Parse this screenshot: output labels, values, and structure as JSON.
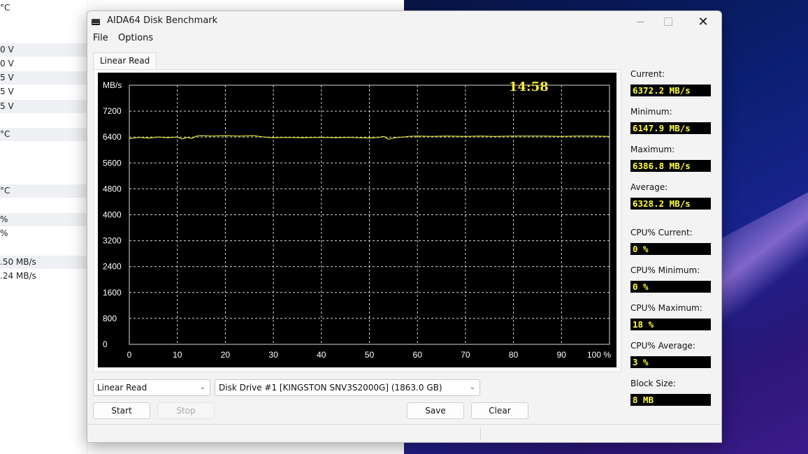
{
  "background_window": {
    "rows": [
      "°C",
      "0 V",
      "0 V",
      "5 V",
      "5 V",
      "5 V",
      "°C",
      "°C",
      "%",
      "%",
      ".50 MB/s",
      ".24 MB/s"
    ]
  },
  "window": {
    "title": "AIDA64 Disk Benchmark",
    "icon": "disk-drive-icon",
    "controls": {
      "minimize": "minimize-icon",
      "maximize": "maximize-icon",
      "close": "✕"
    }
  },
  "menu": [
    "File",
    "Options"
  ],
  "tab": {
    "label": "Linear Read"
  },
  "chart_data": {
    "type": "line",
    "ylabel": "MB/s",
    "ylim": [
      0,
      8000
    ],
    "yticks": [
      "7200",
      "6400",
      "5600",
      "4800",
      "4000",
      "3200",
      "2400",
      "1600",
      "800",
      "0"
    ],
    "xlim": [
      0,
      100
    ],
    "xticks": [
      "0",
      "10",
      "20",
      "30",
      "40",
      "50",
      "60",
      "70",
      "80",
      "90",
      "100 %"
    ],
    "grid": true,
    "line_color": "#e6e63a",
    "elapsed": "14:58",
    "series": [
      {
        "x": [
          0,
          2,
          4,
          6,
          8,
          10,
          11,
          12,
          13,
          14,
          15,
          17,
          20,
          23,
          26,
          28,
          30,
          33,
          36,
          40,
          43,
          46,
          50,
          52,
          53,
          54,
          55,
          56,
          57,
          58,
          60,
          63,
          66,
          70,
          73,
          76,
          80,
          83,
          86,
          90,
          93,
          96,
          100
        ],
        "values": [
          6350,
          6390,
          6370,
          6400,
          6380,
          6400,
          6340,
          6390,
          6360,
          6430,
          6440,
          6430,
          6440,
          6430,
          6440,
          6400,
          6380,
          6390,
          6380,
          6390,
          6380,
          6390,
          6370,
          6390,
          6420,
          6330,
          6370,
          6390,
          6400,
          6420,
          6430,
          6420,
          6430,
          6420,
          6430,
          6420,
          6430,
          6430,
          6430,
          6420,
          6430,
          6430,
          6420
        ]
      }
    ]
  },
  "stats": [
    {
      "label": "Current:",
      "value": "6372.2 MB/s"
    },
    {
      "label": "Minimum:",
      "value": "6147.9 MB/s"
    },
    {
      "label": "Maximum:",
      "value": "6386.8 MB/s"
    },
    {
      "label": "Average:",
      "value": "6328.2 MB/s"
    },
    {
      "label": "CPU% Current:",
      "value": "0 %"
    },
    {
      "label": "CPU% Minimum:",
      "value": "0 %"
    },
    {
      "label": "CPU% Maximum:",
      "value": "18 %"
    },
    {
      "label": "CPU% Average:",
      "value": "3 %"
    },
    {
      "label": "Block Size:",
      "value": "8 MB"
    }
  ],
  "controls": {
    "test_select": "Linear Read",
    "drive_select": "Disk Drive #1  [KINGSTON SNV3S2000G]  (1863.0 GB)",
    "start": "Start",
    "stop": "Stop",
    "save": "Save",
    "clear": "Clear"
  }
}
